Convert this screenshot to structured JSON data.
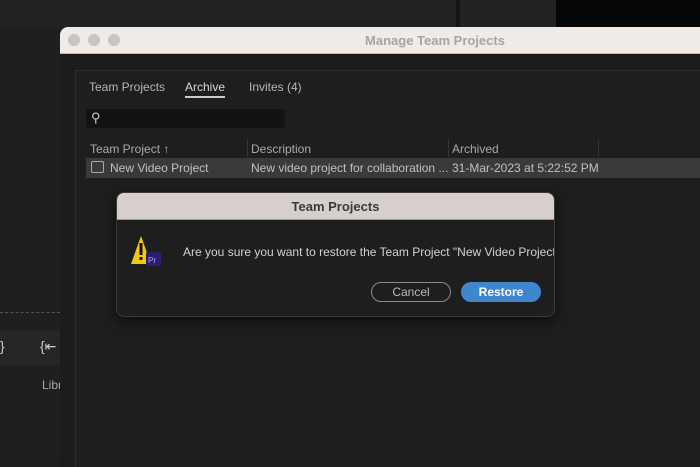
{
  "background": {
    "panel_label": "Libr"
  },
  "window": {
    "title": "Manage Team Projects"
  },
  "tabs": [
    {
      "label": "Team Projects"
    },
    {
      "label": "Archive",
      "active": true
    },
    {
      "label": "Invites (4)"
    }
  ],
  "search": {
    "value": ""
  },
  "table": {
    "headers": [
      "Team Project",
      "Description",
      "Archived"
    ],
    "sort_indicator": "↑",
    "rows": [
      {
        "name": "New Video Project",
        "description": "New video project for collaboration ...",
        "archived": "31-Mar-2023 at 5:22:52 PM"
      }
    ]
  },
  "dialog": {
    "title": "Team Projects",
    "message": "Are you sure you want to restore the Team Project \"New Video Project \"?",
    "badge": "Pr",
    "cancel_label": "Cancel",
    "restore_label": "Restore"
  },
  "colors": {
    "accent": "#3f86cf",
    "warning": "#f2c811",
    "pr_badge": "#2a1f6b"
  }
}
